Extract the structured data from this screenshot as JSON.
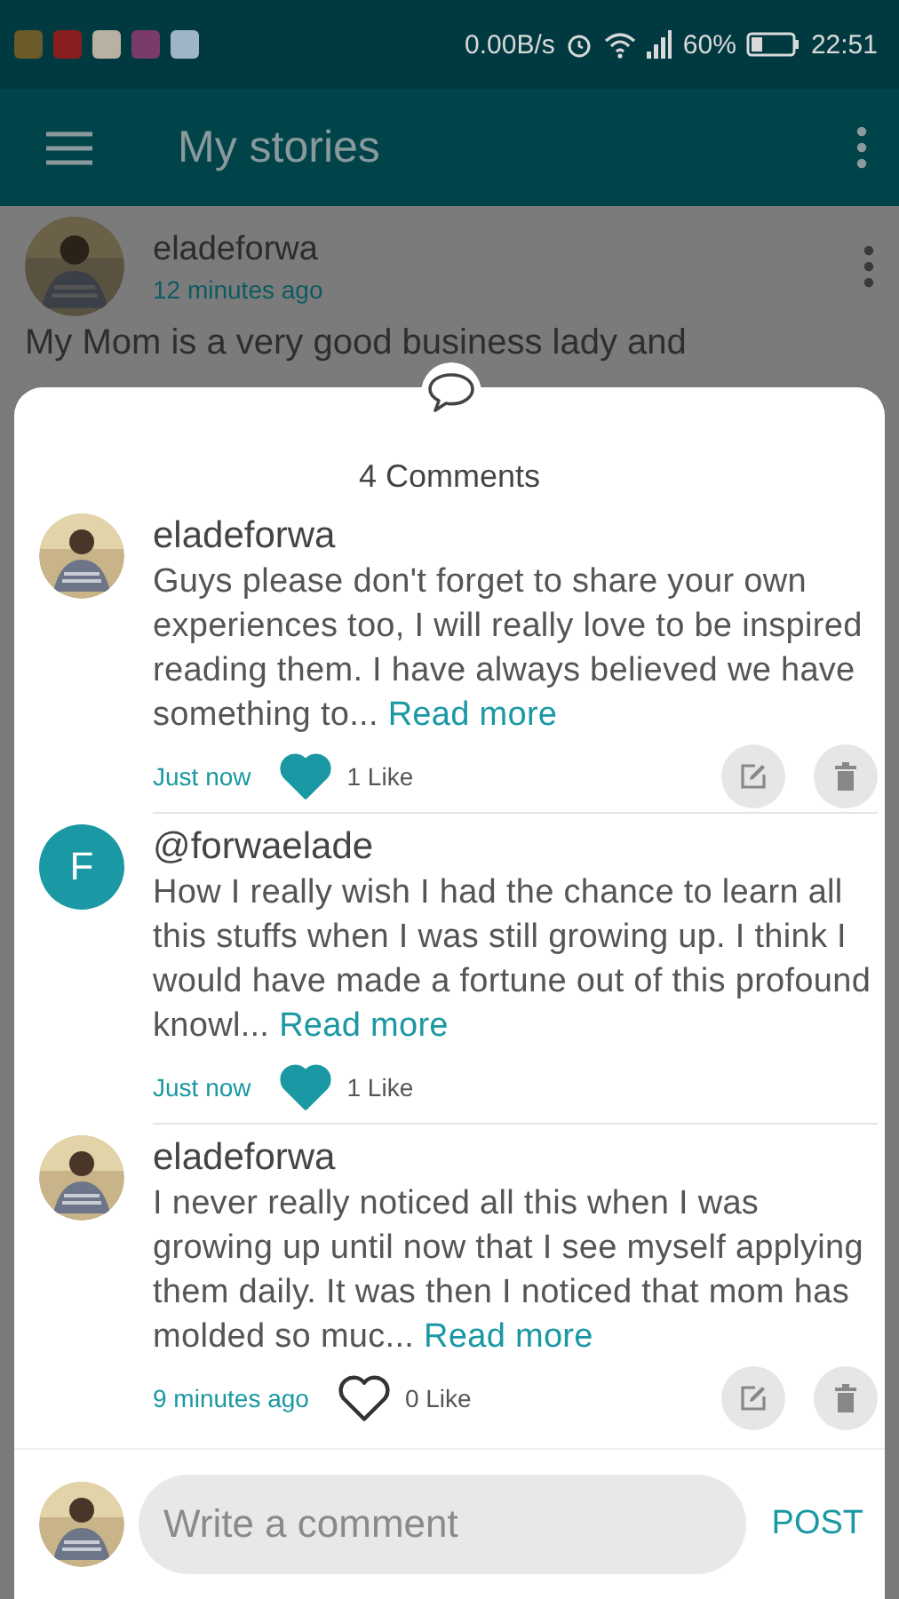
{
  "status_bar": {
    "net_speed": "0.00B/s",
    "battery": "60%",
    "time": "22:51"
  },
  "app_bar": {
    "title": "My stories"
  },
  "story": {
    "author": "eladeforwa",
    "time": "12 minutes ago",
    "text": "My Mom is a very good business lady and"
  },
  "comments_sheet": {
    "title": "4 Comments",
    "comments": [
      {
        "kind": "picture",
        "author": "eladeforwa",
        "text": "Guys please don't forget to share your own experiences too, I will really love to be inspired reading them. I have always believed we have something to...",
        "read_more": "Read more",
        "time": "Just now",
        "liked": true,
        "likes": "1 Like",
        "editable": true
      },
      {
        "kind": "letter",
        "initial": "F",
        "author": "@forwaelade",
        "text": "How I really wish I had the chance to learn all this stuffs when I was still growing up. I think I would have made a fortune out of this profound knowl...",
        "read_more": "Read more",
        "time": "Just now",
        "liked": true,
        "likes": "1 Like",
        "editable": false
      },
      {
        "kind": "picture",
        "author": "eladeforwa",
        "text": "I never really noticed all this when I was growing up until now that I see myself applying them daily. It was then I noticed that mom has molded so muc...",
        "read_more": "Read more",
        "time": "9 minutes ago",
        "liked": false,
        "likes": "0 Like",
        "editable": true
      }
    ],
    "composer": {
      "placeholder": "Write a comment",
      "post": "POST"
    }
  }
}
